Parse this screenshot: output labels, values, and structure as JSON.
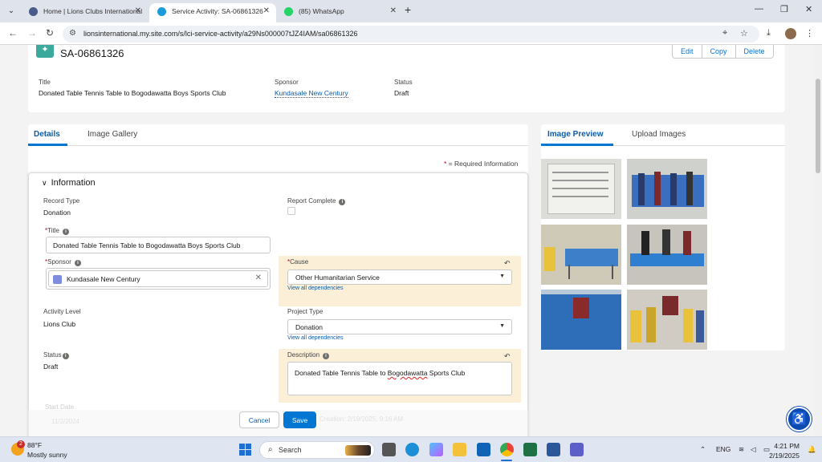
{
  "browser": {
    "tabs": [
      {
        "title": "Home | Lions Clubs International",
        "active": false,
        "favicon_color": "#4a5a8a"
      },
      {
        "title": "Service Activity: SA-06861326",
        "active": true,
        "favicon_color": "#1a9ad6"
      },
      {
        "title": "(85) WhatsApp",
        "active": false,
        "favicon_color": "#25d366"
      }
    ],
    "url": "lionsinternational.my.site.com/s/lci-service-activity/a29Ns000007tJZ4IAM/sa06861326"
  },
  "record": {
    "name": "SA-06861326",
    "actions": {
      "edit": "Edit",
      "copy": "Copy",
      "delete": "Delete"
    },
    "highlights": {
      "title_label": "Title",
      "title_value": "Donated Table Tennis Table to Bogodawatta Boys Sports Club",
      "sponsor_label": "Sponsor",
      "sponsor_value": "Kundasale New Century",
      "status_label": "Status",
      "status_value": "Draft"
    }
  },
  "main_tabs": {
    "details": "Details",
    "gallery": "Image Gallery"
  },
  "required_info": {
    "star": "*",
    "text": " = Required Information"
  },
  "section": {
    "title": "Information",
    "record_type_label": "Record Type",
    "record_type_value": "Donation",
    "report_complete_label": "Report Complete",
    "title_label": "Title",
    "title_value": "Donated Table Tennis Table to Bogodawatta Boys Sports Club",
    "sponsor_label": "Sponsor",
    "sponsor_value": "Kundasale New Century",
    "cause_label": "Cause",
    "cause_value": "Other Humanitarian Service",
    "dependencies_link": "View all dependencies",
    "activity_level_label": "Activity Level",
    "activity_level_value": "Lions Club",
    "project_type_label": "Project Type",
    "project_type_value": "Donation",
    "status_label": "Status",
    "status_value": "Draft",
    "description_label": "Description",
    "description_value_a": "Donated Table Tennis Table to ",
    "description_value_b": "Bogodawatta",
    "description_value_c": " Sports Club",
    "start_date_label": "Start Date",
    "start_date_value": "11/2/2024",
    "created_text": "Creation: 2/19/2025, 9:16 AM"
  },
  "footer": {
    "cancel": "Cancel",
    "save": "Save"
  },
  "side_tabs": {
    "preview": "Image Preview",
    "upload": "Upload Images"
  },
  "taskbar": {
    "weather_temp": "88°F",
    "weather_desc": "Mostly sunny",
    "weather_badge": "2",
    "search_label": "Search",
    "lang": "ENG",
    "time": "4:21 PM",
    "date": "2/19/2025"
  },
  "colors": {
    "brand": "#0176d3",
    "changed_field_bg": "#fbefd8",
    "required": "#ba0517"
  }
}
